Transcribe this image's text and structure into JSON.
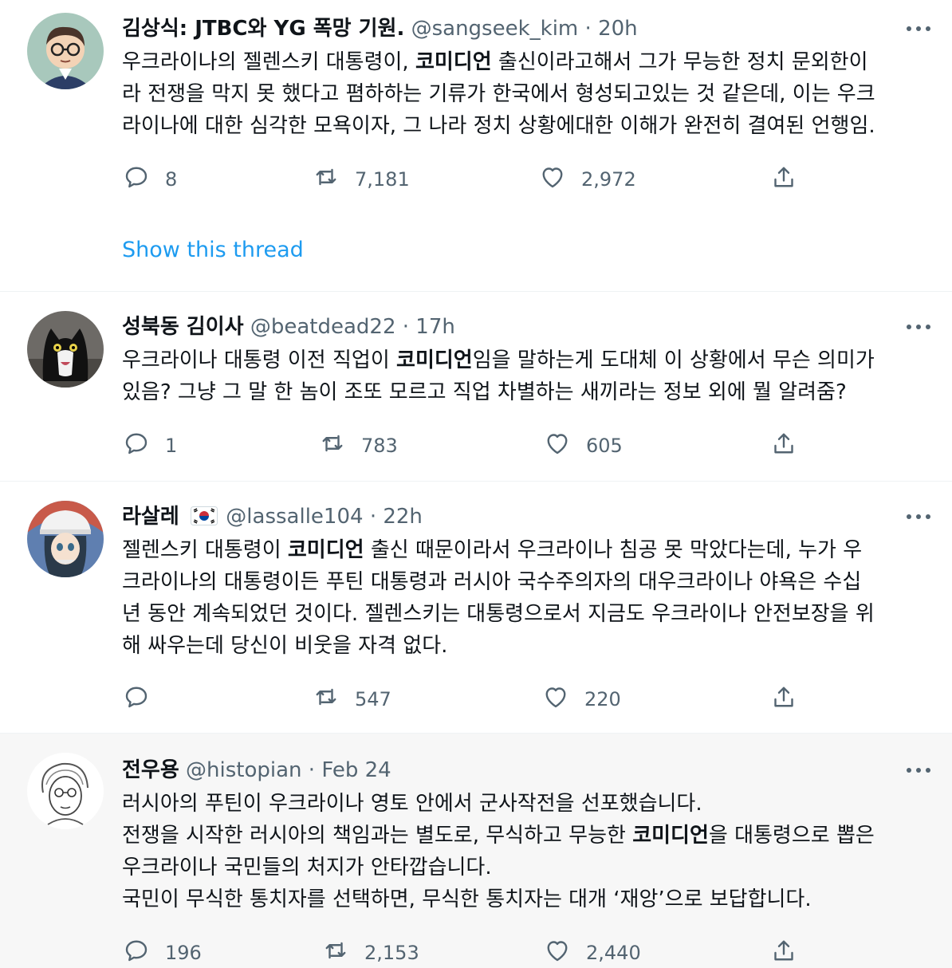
{
  "tweets": [
    {
      "display_name": "김상식: JTBC와 YG 폭망 기원.",
      "handle": "@sangseek_kim",
      "time": "20h",
      "lines": [
        [
          "우크라이나의 젤렌스키 대통령이, ",
          "코미디언",
          " 출신이라고해서 그가 무능한 정치 문외한이"
        ],
        [
          "라 전쟁을 막지 못 했다고 폄하하는 기류가 한국에서 형성되고있는 것 같은데, 이는 우크"
        ],
        [
          "라이나에 대한 심각한 모욕이자, 그 나라 정치 상황에대한 이해가 완전히 결여된 언행임."
        ]
      ],
      "replies": "8",
      "retweets": "7,181",
      "likes": "2,972",
      "show_thread": "Show this thread"
    },
    {
      "display_name": "성북동 김이사",
      "handle": "@beatdead22",
      "time": "17h",
      "lines": [
        [
          "우크라이나 대통령 이전 직업이 ",
          "코미디언",
          "임을 말하는게 도대체 이 상황에서 무슨 의미가"
        ],
        [
          "있음? 그냥 그 말 한 놈이 조또 모르고 직업 차별하는 새끼라는 정보 외에 뭘 알려줌?"
        ]
      ],
      "replies": "1",
      "retweets": "783",
      "likes": "605"
    },
    {
      "display_name": "라살레",
      "handle": "@lassalle104",
      "time": "22h",
      "lines": [
        [
          "젤렌스키 대통령이 ",
          "코미디언",
          " 출신 때문이라서 우크라이나 침공 못 막았다는데, 누가 우"
        ],
        [
          "크라이나의 대통령이든 푸틴 대통령과 러시아 국수주의자의 대우크라이나 야욕은 수십"
        ],
        [
          "년 동안 계속되었던 것이다. 젤렌스키는 대통령으로서 지금도 우크라이나 안전보장을 위"
        ],
        [
          "해 싸우는데 당신이 비웃을 자격 없다."
        ]
      ],
      "replies": "",
      "retweets": "547",
      "likes": "220"
    },
    {
      "display_name": "전우용",
      "handle": "@histopian",
      "time": "Feb 24",
      "lines": [
        [
          "러시아의 푸틴이 우크라이나 영토 안에서 군사작전을 선포했습니다."
        ],
        [
          "전쟁을 시작한 러시아의 책임과는 별도로, 무식하고 무능한 ",
          "코미디언",
          "을 대통령으로 뽑은"
        ],
        [
          "우크라이나 국민들의 처지가 안타깝습니다."
        ],
        [
          "국민이 무식한 통치자를 선택하면, 무식한 통치자는 대개 ‘재앙’으로 보답합니다."
        ]
      ],
      "replies": "196",
      "retweets": "2,153",
      "likes": "2,440"
    }
  ],
  "icons": {
    "reply": "reply-icon",
    "retweet": "retweet-icon",
    "like": "heart-icon",
    "share": "share-icon",
    "more": "more-icon"
  },
  "colors": {
    "link": "#1d9bf0",
    "secondary": "#536471",
    "text": "#0f1419",
    "highlight_bg": "#f7f7f7"
  }
}
